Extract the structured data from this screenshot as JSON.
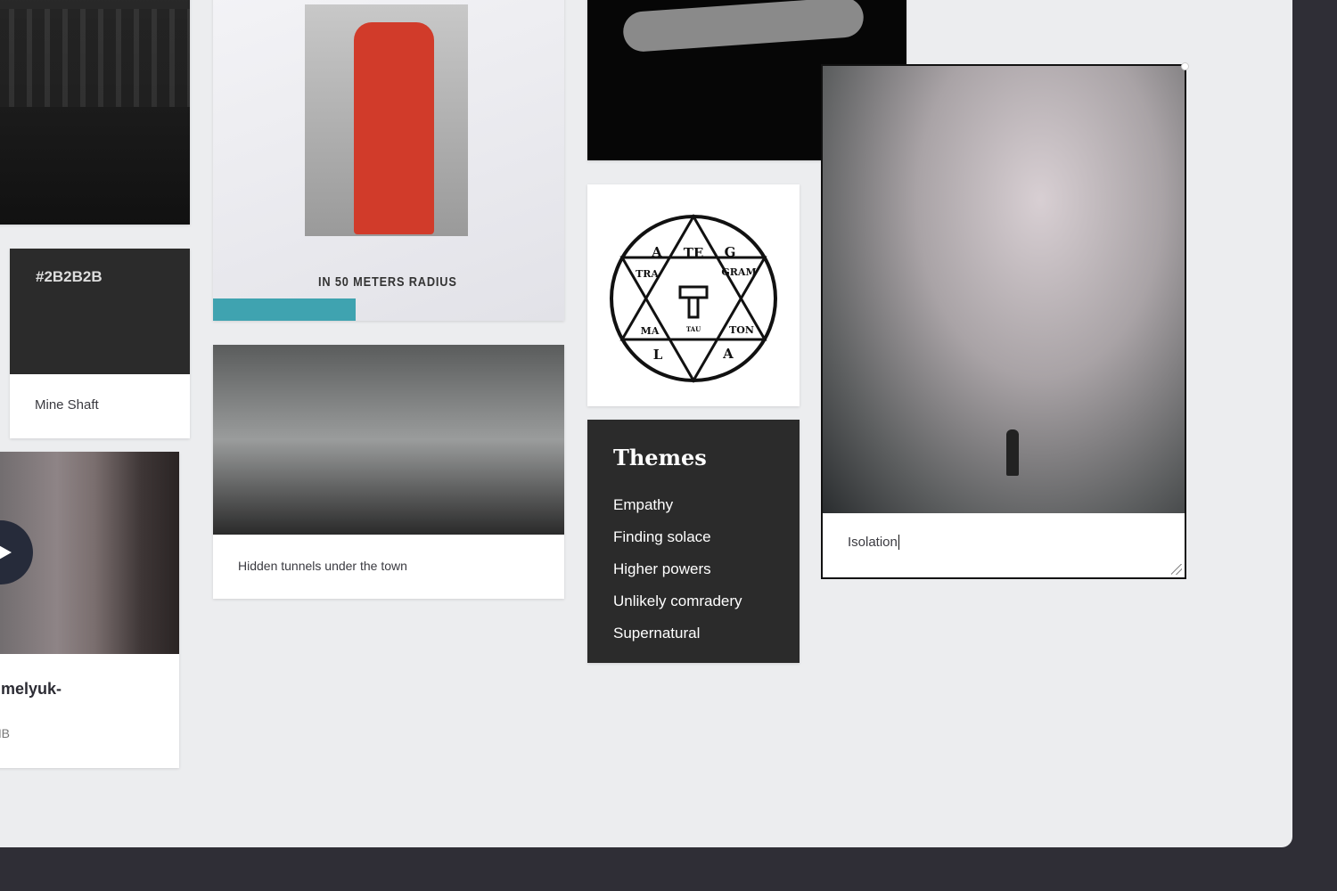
{
  "cards": {
    "color_swatch": {
      "hex": "#2B2B2B",
      "name": "Mine Shaft",
      "color": "#2B2B2B"
    },
    "poster": {
      "text": "IN 50 METERS RADIUS"
    },
    "forest": {
      "caption": "Hidden tunnels under the town"
    },
    "video": {
      "title": "nmelyuk-",
      "size": "MB"
    },
    "themes": {
      "title": "Themes",
      "items": [
        "Empathy",
        "Finding solace",
        "Higher powers",
        "Unlikely comradery",
        "Supernatural"
      ]
    },
    "fog": {
      "caption_value": "Isolation"
    },
    "sigil": {
      "words": [
        "A",
        "TE",
        "G",
        "TRA",
        "GRAM",
        "MA",
        "TAU",
        "TON",
        "L",
        "A"
      ]
    }
  }
}
